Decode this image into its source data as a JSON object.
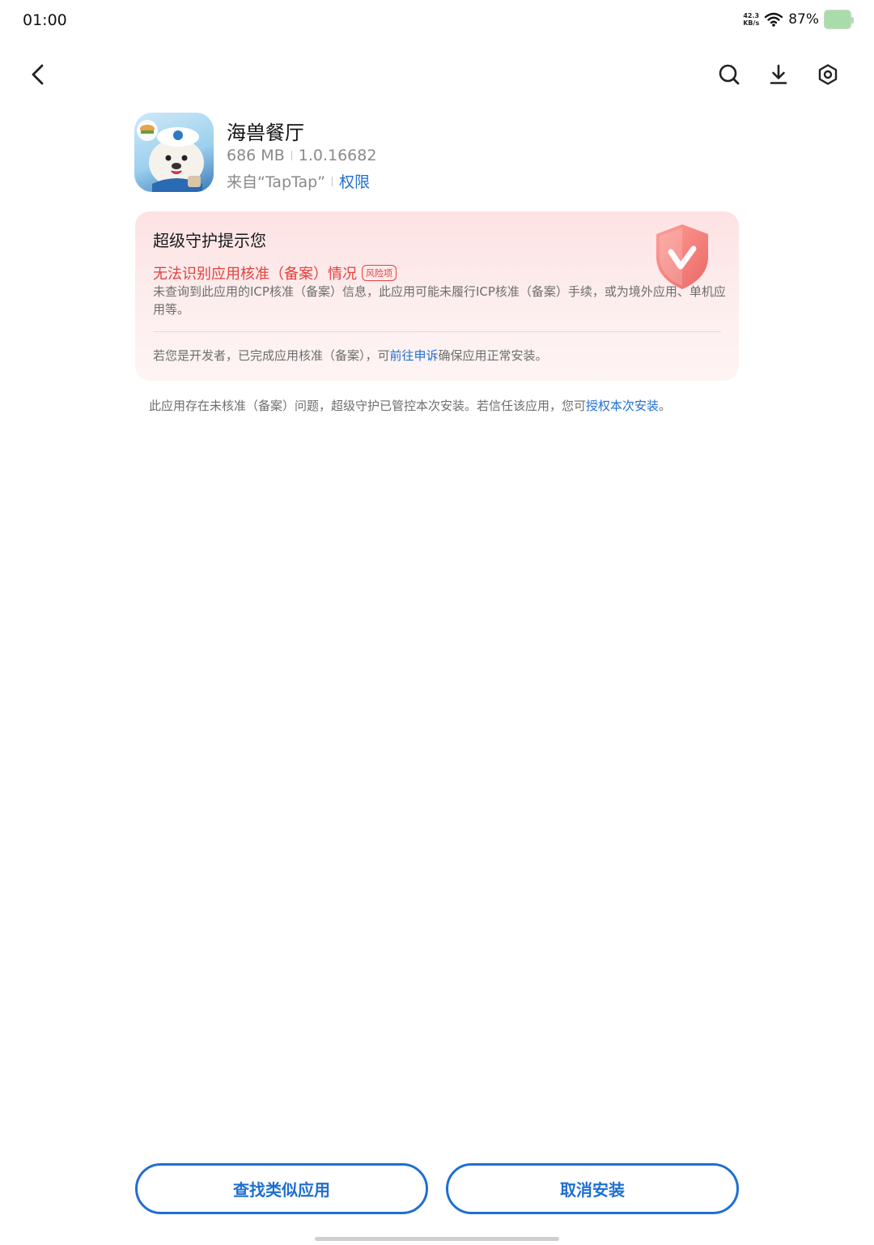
{
  "status_bar": {
    "time": "01:00",
    "net_speed_value": "42.3",
    "net_speed_unit": "KB/s",
    "battery": "87%"
  },
  "toolbar": {
    "back_icon": "chevron-left-icon",
    "search_icon": "search-icon",
    "download_icon": "download-icon",
    "settings_icon": "settings-icon"
  },
  "app": {
    "name": "海兽餐厅",
    "size": "686 MB",
    "version": "1.0.16682",
    "source": "来自“TapTap”",
    "permissions_link": "权限"
  },
  "protection_card": {
    "title": "超级守护提示您",
    "risk_title": "无法识别应用核准（备案）情况",
    "risk_badge": "风险项",
    "risk_description": "未查询到此应用的ICP核准（备案）信息，此应用可能未履行ICP核准（备案）手续，或为境外应用、单机应用等。",
    "developer_note_prefix": "若您是开发者，已完成应用核准（备案），可",
    "developer_note_link": "前往申诉",
    "developer_note_suffix": "确保应用正常安装。",
    "accent_color": "#e5403d"
  },
  "bottom_note": {
    "prefix": "此应用存在未核准（备案）问题，超级守护已管控本次安装。若信任该应用，您可",
    "link": "授权本次安装",
    "suffix": "。"
  },
  "actions": {
    "find_similar": "查找类似应用",
    "cancel_install": "取消安装",
    "accent_color": "#1f6fd1"
  }
}
